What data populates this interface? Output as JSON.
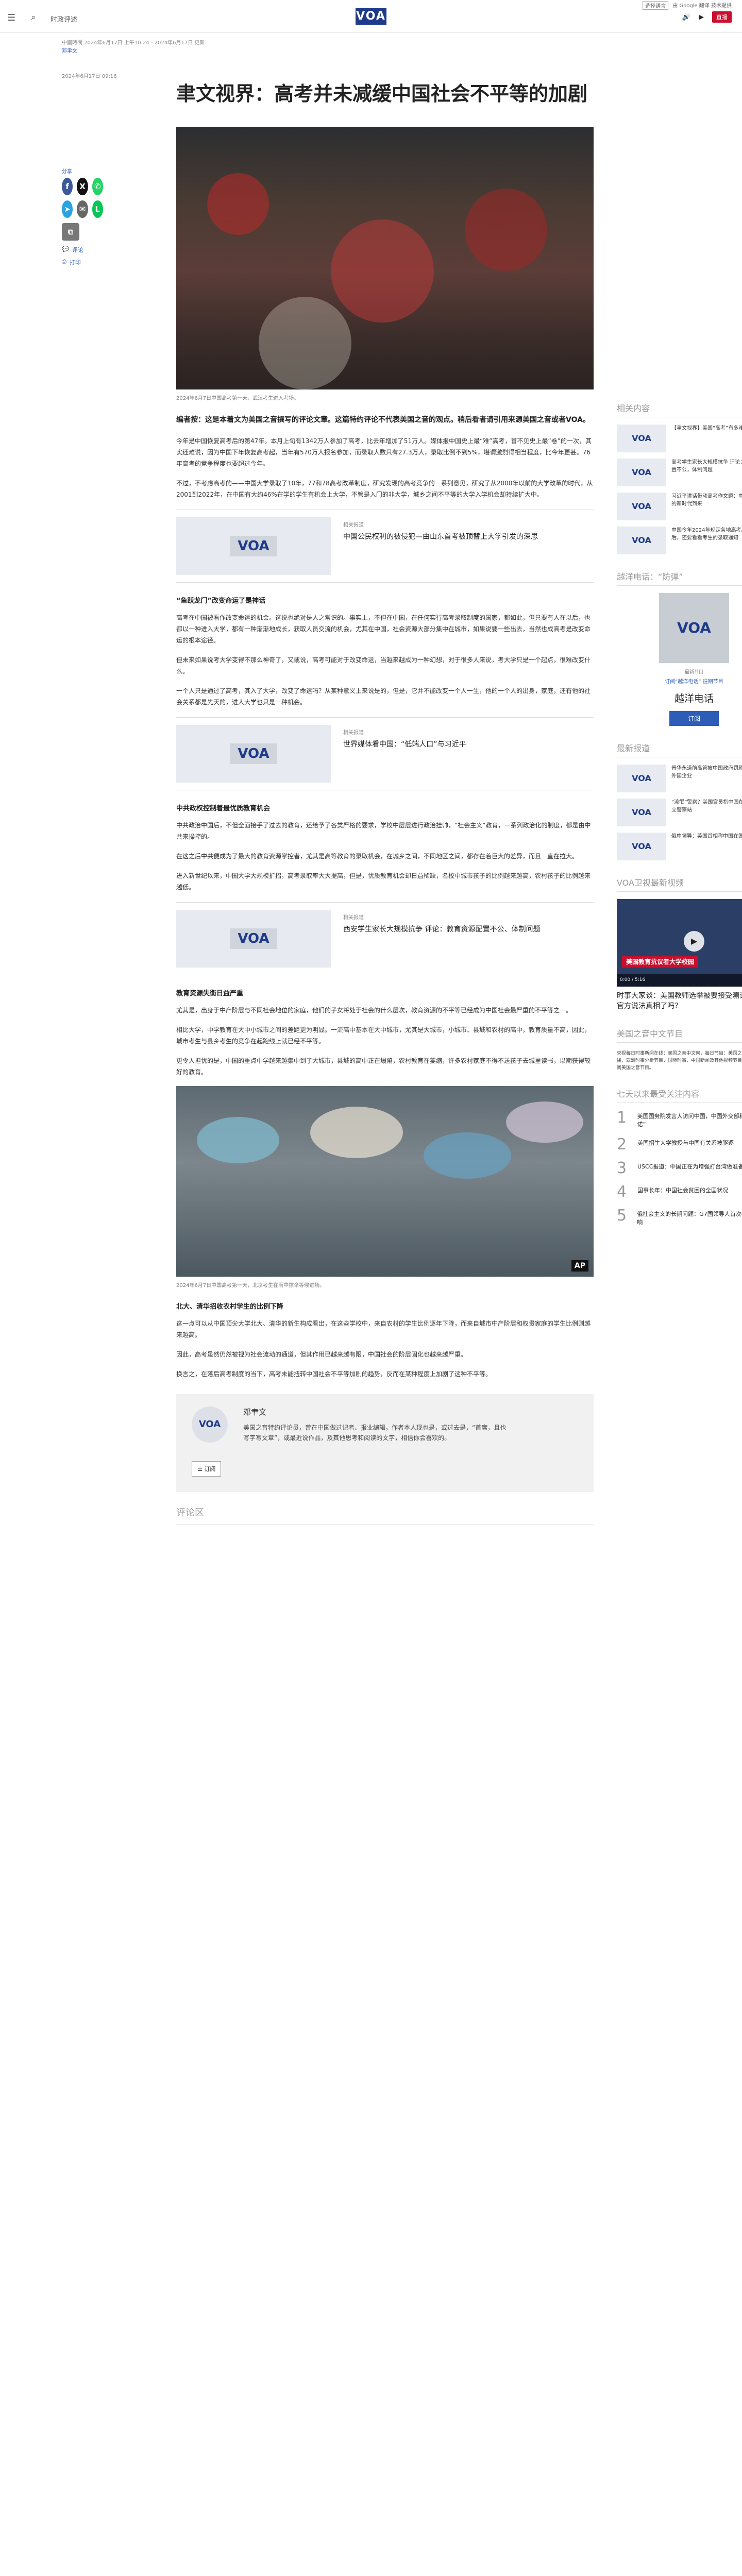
{
  "header": {
    "section": "时政评述",
    "logo": "VOA",
    "live": "直播",
    "lang_select": "选择语言",
    "google": "由 Google 翻译 技术提供"
  },
  "meta": {
    "updated": "中國時間 2024年6月17日 上午10:24 - 2024年6月17日 更新",
    "author": "邓聿文"
  },
  "article": {
    "title": "聿文视界：高考并未减缓中国社会不平等的加剧",
    "dateline": "2024年6月17日 09:16",
    "share_label": "分享",
    "print": "评论",
    "print2": "打印",
    "hero_caption": "2024年6月7日中国高考第一天，武汉考生进入考场。",
    "lead": "编者按：这是本着文为美国之音撰写的评论文章。这篇特约评论不代表美国之音的观点。稍后看者请引用来源美国之音或者VOA。",
    "p1": "今年是中国恢复高考后的第47年。本月上旬有1342万人参加了高考，比去年增加了51万人。媒体报中国史上最“难”高考，首不见史上最“卷”的一次，其实还难说，因为中国下年恢复高考起，当年有570万人报名参加，而录取人数只有27.3万人，录取比例不到5%，堪谓激烈得相当程度，比今年更甚。76年高考的竞争程度也要超过今年。",
    "p2": "不过，不考虑高考的——中国大学录取了10年，77和78高考改革制度，研究发现的高考竞争的一系列意见，研究了从2000年以前的大学改革的时代，从2001到2022年，在中国有大约46%在学的学生有机会上大学，不管是入门的非大学，城乡之间不平等的大学入学机会却持续扩大中。",
    "rel1_kicker": "相关报道",
    "rel1_title": "中国公民权利的被侵犯—由山东首考被顶替上大学引发的深思",
    "sub1": "“鱼跃龙门”改变命运了是神话",
    "p3": "高考在中国被看作改变命运的机会。这说也绝对是人之常识的。事实上，不但在中国，在任何实行高考录取制度的国家，都如此，但只要有人在以后，也都以一种进入大学，都有一种渐渐地成长，获取人员交流的机会，尤其在中国，社会资源大部分集中在城市，如果说要一些出去，当然也成高考是改变命运的根本途径。",
    "p4": "但未来如果说考大学变得不那么神奇了，又或说，高考可能对于改变命运，当越来越成为一种幻想，对于很多人来说，考大学只是一个起点，很难改变什么。",
    "p5": "一个人只是通过了高考，其入了大学，改变了命运吗？从某种意义上来说是的，但是，它并不能改变一个人一生，他的一个人的出身，家庭，还有他的社会关系都是先天的，进人大学也只是一种机会。",
    "rel2_kicker": "相关报道",
    "rel2_title": "世界媒体看中国：“低端人口”与习近平",
    "sub2": "中共政权控制着最优质教育机会",
    "p6": "中共政治中国后，不但全面接手了过去的教育，还给予了各类严格的要求，学校中层层进行政治挂帅，“社会主义”教育，一系列政治化的制度，都是由中共来操控的。",
    "p7": "在这之后中共便成为了最大的教育资源掌控者，尤其是高等教育的录取机会，在城乡之间，不同地区之间，都存在着巨大的差异，而且一直在拉大。",
    "p8": "进入新世纪以来，中国大学大规模扩招，高考录取率大大提高，但是，优质教育机会却日益稀缺，名校中城市孩子的比例越来越高，农村孩子的比例越来越低。",
    "rel3_kicker": "相关报道",
    "rel3_title": "西安学生家长大规模抗争 评论：教育资源配置不公、体制问题",
    "sub3": "教育资源失衡日益严重",
    "p9": "尤其是，出身于中产阶层与不同社会地位的家庭，他们的子女将处于社会的什么层次，教育资源的不平等已经成为中国社会最严重的不平等之一。",
    "p10": "相比大学，中学教育在大中小城市之间的差距更为明显。一流高中基本在大中城市，尤其是大城市，小城市、县城和农村的高中，教育质量不高，因此，城市考生与县乡考生的竞争在起跑线上就已经不平等。",
    "p11": "更令人担忧的是，中国的重点中学越来越集中到了大城市，县城的高中正在塌陷，农村教育在萎缩，许多农村家庭不得不送孩子去城里读书，以期获得较好的教育。",
    "photo2_caption": "2024年6月7日中国高考第一天，北京考生在雨中撑伞等候进场。",
    "sub4": "北大、清华招收农村学生的比例下降",
    "p12": "这一点可以从中国顶尖大学北大、清华的新生构成看出，在这些学校中，来自农村的学生比例逐年下降，而来自城市中产阶层和权贵家庭的学生比例则越来越高。",
    "p13": "因此，高考虽然仍然被视为社会流动的通道，但其作用已越来越有限，中国社会的阶层固化也越来越严重。",
    "p14": "换言之，在落后高考制度的当下，高考未能扭转中国社会不平等加剧的趋势，反而在某种程度上加剧了这种不平等。",
    "bio_name": "邓聿文",
    "bio_desc": "美国之音特约评论员，曾在中国做过记者、报业编辑，作者本人现也是，或过去是，“首席，且也写字写文章”，或最近说作品，及其他思考和阅读的文字，相信你会喜欢的。",
    "bio_rss": "订阅",
    "comments": "评论区"
  },
  "sidebar": {
    "related_head": "相关内容",
    "related": [
      {
        "thumb": "VOA",
        "text": "【聿文视界】美国“高考”有多难？"
      },
      {
        "thumb": "VOA",
        "text": "高考学生家长大规模抗争 评论：教育资源配置不公，体制问题"
      },
      {
        "thumb": "VOA",
        "text": "习近平讲话带动高考作文题：中国民族教育的新时代到来"
      },
      {
        "thumb": "VOA",
        "text": "中国今年2024年规定各地高考高中学生之后，还要看看考生的录取通知"
      }
    ],
    "mag_head": "越洋电话：“防弹”",
    "mag_hint": "最新节目",
    "mag_links": "订阅“越洋电话”   往期节目",
    "mag_title": "越洋电话",
    "mag_sub": "订阅",
    "news_head": "最新报道",
    "news": [
      {
        "thumb": "VOA",
        "text": "普华永道前高管被中国政府罚款，中国警告外国企业"
      },
      {
        "thumb": "VOA",
        "text": "“流氓”警察？美国官员指中国在世界各地设立警察站"
      },
      {
        "thumb": "VOA",
        "text": "俄中领导：英国首相称中国在国际上不可信"
      }
    ],
    "video_head": "VOA卫视最新视频",
    "video_banner": "美国教育抗议者大学校园",
    "video_time": "0:00 / 5:16",
    "video_title": "时事大家谈：美国教师选举被要接受测试？中国官方说法真相了吗？",
    "mid_head": "美国之音中文节目",
    "mid_text": "央视每日时事新闻在线：美国之音中文网，每日节目：美国之音新闻中文直播，亚洲时事分析节目，国际时事，中国新闻及其他视频节目，欢迎关注订阅美国之音节目。",
    "top_head": "七天以来最受关注内容",
    "top": [
      {
        "n": "1",
        "text": "美国国务院发言人访问中国，中国外交部称“履行承诺”"
      },
      {
        "n": "2",
        "text": "美国招生大学教授与中国有关系被驱逐"
      },
      {
        "n": "3",
        "text": "USCC报道：中国正在为增强打台湾做准备"
      },
      {
        "n": "4",
        "text": "国事长年：中国社会贫困的全国状况"
      },
      {
        "n": "5",
        "text": "俄社会主义的长期问题：G7国领导人首次在中国的影响"
      }
    ]
  }
}
